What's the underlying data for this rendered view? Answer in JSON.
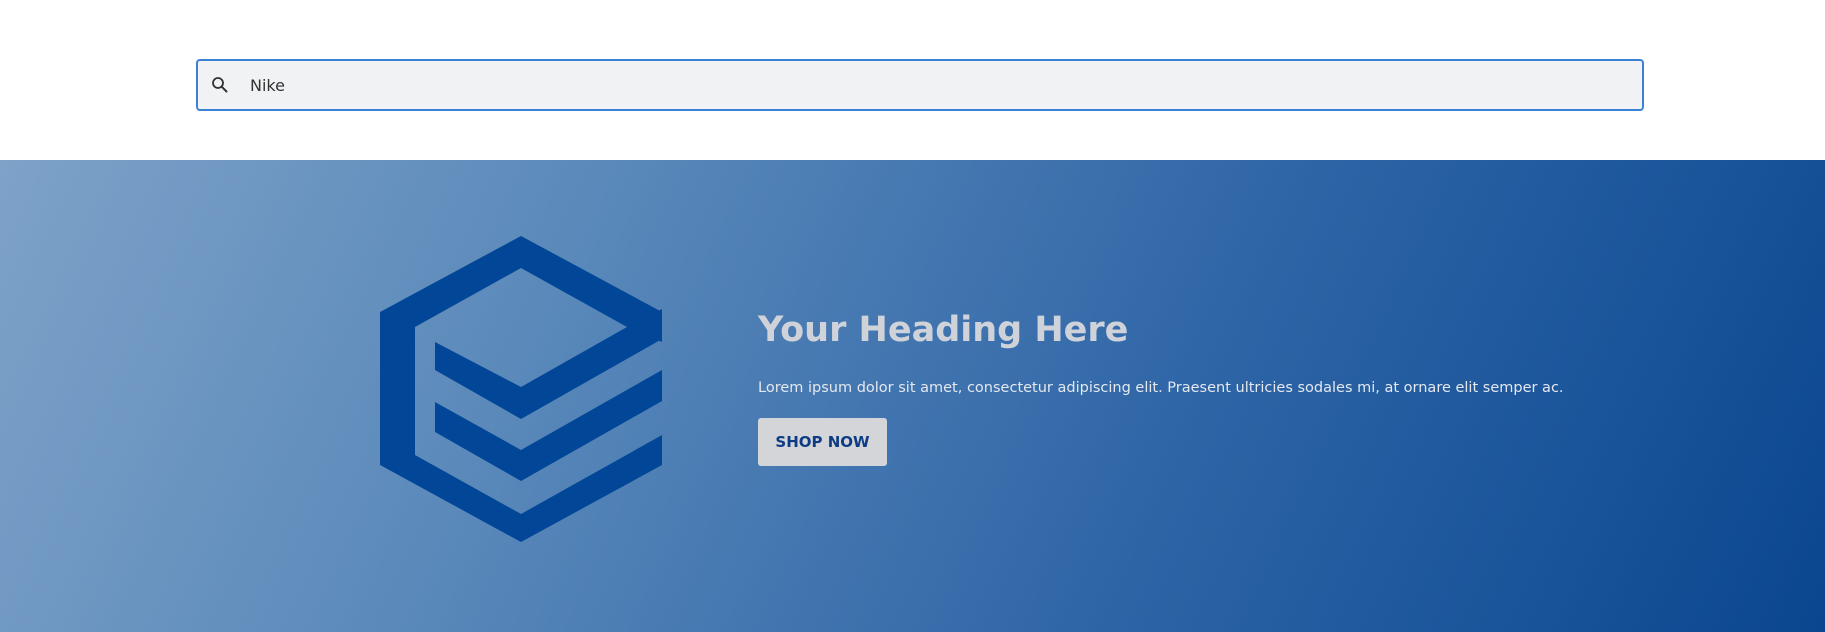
{
  "search": {
    "value": "Nike",
    "icon": "search-icon"
  },
  "hero": {
    "logo_icon": "stacked-hexagon-logo",
    "heading": "Your Heading Here",
    "description": "Lorem ipsum dolor sit amet, consectetur adipiscing elit. Praesent ultricies sodales mi, at ornare elit semper ac.",
    "button_label": "SHOP NOW"
  },
  "colors": {
    "accent_border": "#3b82d6",
    "logo": "#024697",
    "gradient_start": "#7ea2c8",
    "gradient_end": "#0a468f",
    "button_bg": "#d3d5d8",
    "button_text": "#0d3c85"
  }
}
